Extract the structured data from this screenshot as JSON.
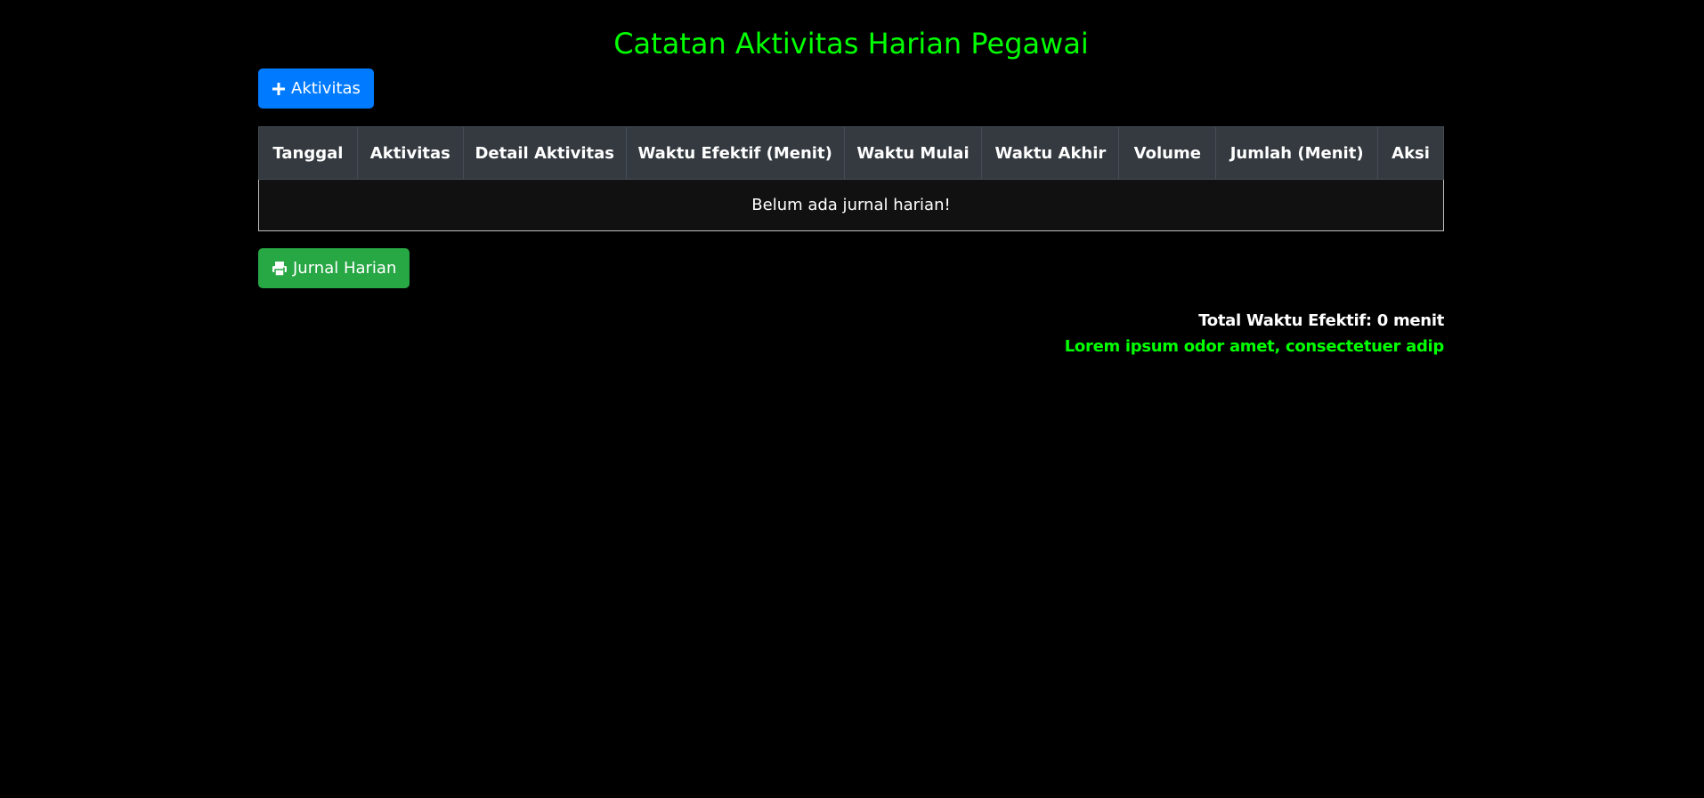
{
  "page": {
    "title": "Catatan Aktivitas Harian Pegawai"
  },
  "toolbar": {
    "add_label": "Aktivitas",
    "add_icon": "plus-icon",
    "print_label": "Jurnal Harian",
    "print_icon": "printer-icon"
  },
  "table": {
    "columns": [
      "Tanggal",
      "Aktivitas",
      "Detail Aktivitas",
      "Waktu Efektif (Menit)",
      "Waktu Mulai",
      "Waktu Akhir",
      "Volume",
      "Jumlah (Menit)",
      "Aksi"
    ],
    "empty_message": "Belum ada jurnal harian!"
  },
  "summary": {
    "total_text": "Total Waktu Efektif: 0 menit",
    "marquee_text": "Lorem ipsum odor amet, consectetuer adip"
  },
  "colors": {
    "background": "#000000",
    "title": "#00ff00",
    "primary_button": "#007bff",
    "success_button": "#28a745",
    "table_header": "#343a40",
    "marquee": "#00ff00"
  }
}
